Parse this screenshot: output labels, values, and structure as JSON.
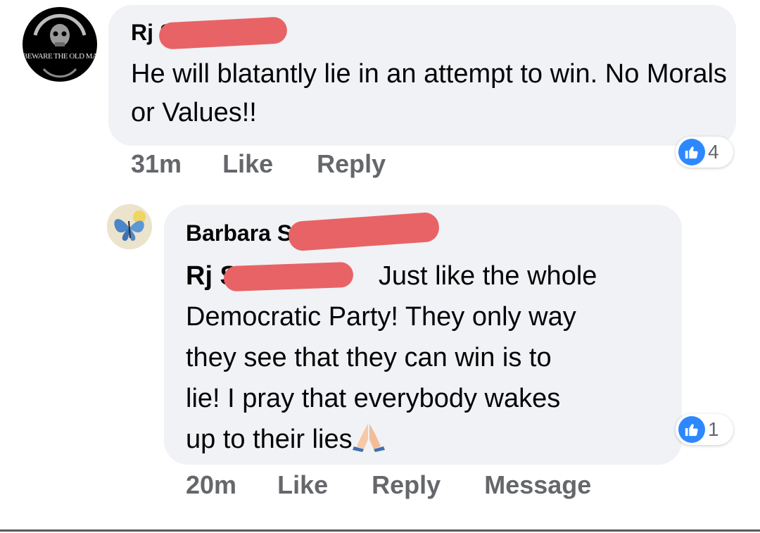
{
  "comments": [
    {
      "author_name": "Rj S",
      "avatar_logo_text": "BEWARE THE OLD MAN",
      "text": "He will blatantly lie in an attempt to win. No Morals or Values!!",
      "time": "31m",
      "like_label": "Like",
      "reply_label": "Reply",
      "reaction_count": "4",
      "reaction_icon": "thumbs-up-icon",
      "reaction_color": "#2d88ff"
    },
    {
      "author_name": "Barbara S",
      "mention": "Rj S",
      "text_lines": [
        "Just like the whole",
        "Democratic Party! They only way",
        "they see that they can win is to",
        "lie! I pray that everybody wakes",
        "up to their lies"
      ],
      "emoji": "🙏",
      "time": "20m",
      "like_label": "Like",
      "reply_label": "Reply",
      "message_label": "Message",
      "reaction_count": "1",
      "reaction_icon": "thumbs-up-icon",
      "reaction_color": "#2d88ff"
    }
  ],
  "colors": {
    "bubble_bg": "#f0f2f5",
    "redaction": "#e86366",
    "action_text": "#65676b"
  }
}
